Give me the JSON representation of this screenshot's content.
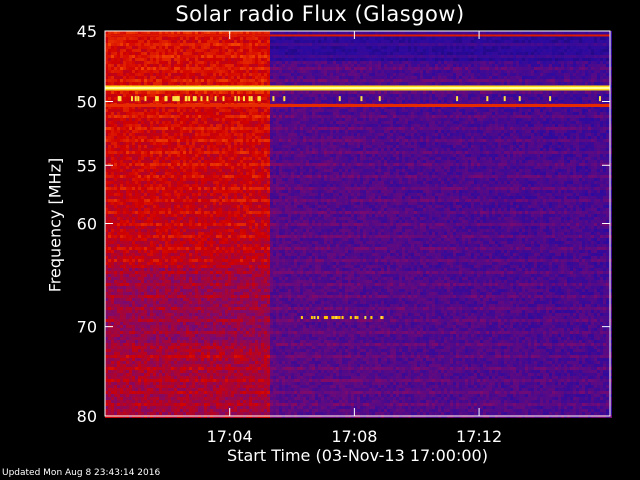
{
  "chart_data": {
    "type": "heatmap",
    "title": "Solar radio Flux (Glasgow)",
    "xlabel": "Start Time (03-Nov-13 17:00:00)",
    "ylabel": "Frequency [MHz]",
    "x_range_minutes": [
      0,
      16.2
    ],
    "x_ticks": [
      {
        "minute": 4,
        "label": "17:04"
      },
      {
        "minute": 8,
        "label": "17:08"
      },
      {
        "minute": 12,
        "label": "17:12"
      }
    ],
    "y_range_mhz": [
      45,
      80
    ],
    "y_scale": "log",
    "y_ticks": [
      {
        "mhz": 45,
        "label": "45"
      },
      {
        "mhz": 50,
        "label": "50"
      },
      {
        "mhz": 55,
        "label": "55"
      },
      {
        "mhz": 60,
        "label": "60"
      },
      {
        "mhz": 70,
        "label": "70"
      },
      {
        "mhz": 80,
        "label": "80"
      }
    ],
    "colormap": [
      "#000000",
      "#2a0aa0",
      "#7a0a70",
      "#d00000",
      "#ff5a00",
      "#ffd000",
      "#ffffa0"
    ],
    "features": {
      "bright_band_mhz": 49,
      "secondary_band_mhz": 50.3,
      "high_intensity_end_minute": 5.2,
      "burst_drift_minute_start": 6.2,
      "burst_mhz": 69
    }
  },
  "footer": {
    "updated": "Updated Mon Aug  8 23:43:14 2016"
  }
}
